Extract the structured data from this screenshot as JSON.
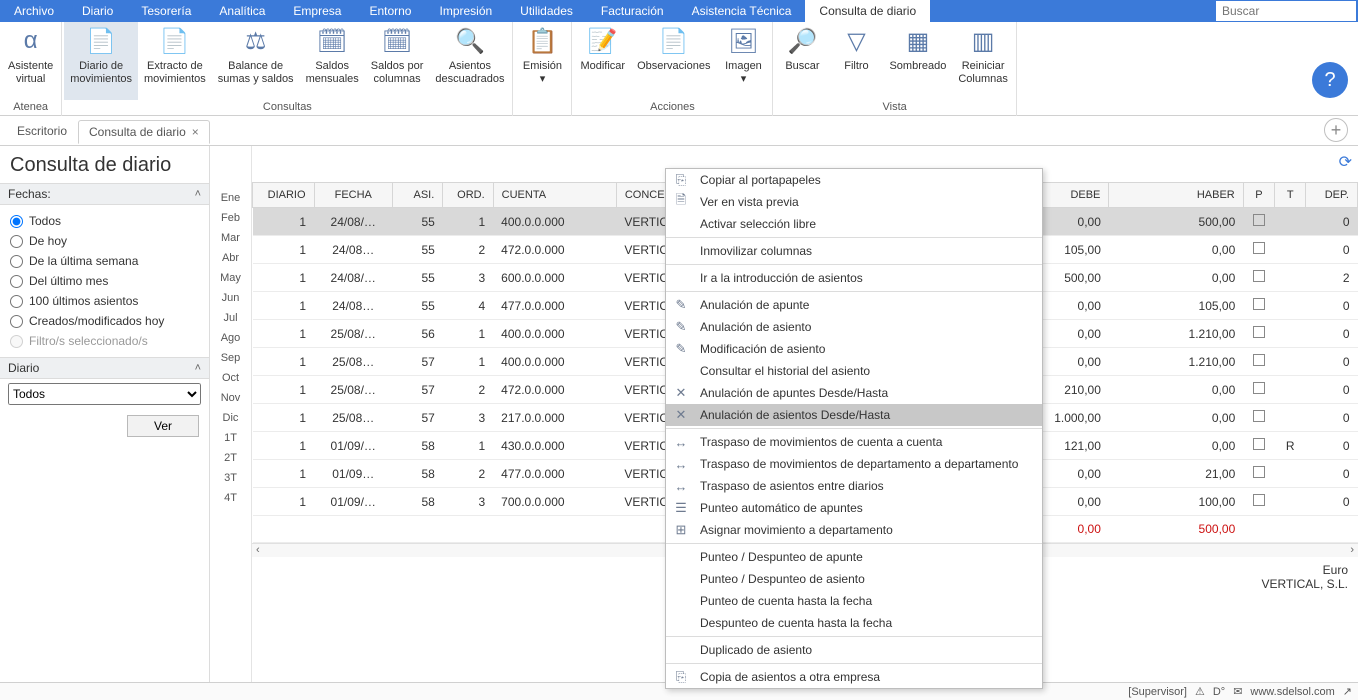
{
  "menubar": [
    "Archivo",
    "Diario",
    "Tesorería",
    "Analítica",
    "Empresa",
    "Entorno",
    "Impresión",
    "Utilidades",
    "Facturación",
    "Asistencia Técnica",
    "Consulta de diario"
  ],
  "menubar_active_index": 10,
  "search_placeholder": "Buscar",
  "ribbon": {
    "groups": [
      {
        "label": "Atenea",
        "buttons": [
          {
            "icon": "α",
            "label": "Asistente\nvirtual",
            "name": "asistente-virtual"
          }
        ]
      },
      {
        "label": "Consultas",
        "buttons": [
          {
            "icon": "📄",
            "label": "Diario de\nmovimientos",
            "name": "diario-de-movimientos",
            "selected": true
          },
          {
            "icon": "📄",
            "label": "Extracto de\nmovimientos",
            "name": "extracto-de-movimientos"
          },
          {
            "icon": "⚖",
            "label": "Balance de\nsumas y saldos",
            "name": "balance-sumas-saldos"
          },
          {
            "icon": "🗓",
            "label": "Saldos\nmensuales",
            "name": "saldos-mensuales"
          },
          {
            "icon": "🗓",
            "label": "Saldos por\ncolumnas",
            "name": "saldos-por-columnas"
          },
          {
            "icon": "🔍",
            "label": "Asientos\ndescuadrados",
            "name": "asientos-descuadrados"
          }
        ]
      },
      {
        "label": "",
        "buttons": [
          {
            "icon": "📋",
            "label": "Emisión\n▾",
            "name": "emision"
          }
        ]
      },
      {
        "label": "Acciones",
        "buttons": [
          {
            "icon": "📝",
            "label": "Modificar",
            "name": "modificar"
          },
          {
            "icon": "📄",
            "label": "Observaciones",
            "name": "observaciones"
          },
          {
            "icon": "🖼",
            "label": "Imagen\n▾",
            "name": "imagen"
          }
        ]
      },
      {
        "label": "Vista",
        "buttons": [
          {
            "icon": "🔎",
            "label": "Buscar",
            "name": "buscar"
          },
          {
            "icon": "▽",
            "label": "Filtro",
            "name": "filtro"
          },
          {
            "icon": "▦",
            "label": "Sombreado",
            "name": "sombreado"
          },
          {
            "icon": "▥",
            "label": "Reiniciar\nColumnas",
            "name": "reiniciar-columnas"
          }
        ]
      }
    ]
  },
  "tabs": {
    "escritorio": "Escritorio",
    "consulta": "Consulta de diario"
  },
  "page_title": "Consulta de diario",
  "fechas_label": "Fechas:",
  "radios": [
    "Todos",
    "De hoy",
    "De la última semana",
    "Del último mes",
    "100 últimos asientos",
    "Creados/modificados hoy",
    "Filtro/s seleccionado/s"
  ],
  "diario_label": "Diario",
  "diario_value": "Todos",
  "ver_label": "Ver",
  "months": [
    "Ene",
    "Feb",
    "Mar",
    "Abr",
    "May",
    "Jun",
    "Jul",
    "Ago",
    "Sep",
    "Oct",
    "Nov",
    "Dic",
    "1T",
    "2T",
    "3T",
    "4T"
  ],
  "columns": [
    "DIARIO",
    "FECHA",
    "ASI.",
    "ORD.",
    "CUENTA",
    "CONCEP",
    "DEBE",
    "HABER",
    "P",
    "T",
    "DEP."
  ],
  "rows": [
    {
      "diario": "1",
      "fecha": "24/08/…",
      "asi": "55",
      "ord": "1",
      "cuenta": "400.0.0.000",
      "concep": "VERTICAL",
      "debe": "0,00",
      "haber": "500,00",
      "p": "",
      "t": "",
      "dep": "0",
      "sel": true
    },
    {
      "diario": "1",
      "fecha": "24/08…",
      "asi": "55",
      "ord": "2",
      "cuenta": "472.0.0.000",
      "concep": "VERTICAL",
      "debe": "105,00",
      "haber": "0,00",
      "p": "",
      "t": "",
      "dep": "0"
    },
    {
      "diario": "1",
      "fecha": "24/08/…",
      "asi": "55",
      "ord": "3",
      "cuenta": "600.0.0.000",
      "concep": "VERTICAL",
      "debe": "500,00",
      "haber": "0,00",
      "p": "",
      "t": "",
      "dep": "2"
    },
    {
      "diario": "1",
      "fecha": "24/08…",
      "asi": "55",
      "ord": "4",
      "cuenta": "477.0.0.000",
      "concep": "VERTICAL",
      "debe": "0,00",
      "haber": "105,00",
      "p": "",
      "t": "",
      "dep": "0"
    },
    {
      "diario": "1",
      "fecha": "25/08/…",
      "asi": "56",
      "ord": "1",
      "cuenta": "400.0.0.000",
      "concep": "VERTICAL",
      "debe": "0,00",
      "haber": "1.210,00",
      "p": "",
      "t": "",
      "dep": "0"
    },
    {
      "diario": "1",
      "fecha": "25/08…",
      "asi": "57",
      "ord": "1",
      "cuenta": "400.0.0.000",
      "concep": "VERTICAL",
      "debe": "0,00",
      "haber": "1.210,00",
      "p": "",
      "t": "",
      "dep": "0"
    },
    {
      "diario": "1",
      "fecha": "25/08/…",
      "asi": "57",
      "ord": "2",
      "cuenta": "472.0.0.000",
      "concep": "VERTICAL",
      "debe": "210,00",
      "haber": "0,00",
      "p": "",
      "t": "",
      "dep": "0"
    },
    {
      "diario": "1",
      "fecha": "25/08…",
      "asi": "57",
      "ord": "3",
      "cuenta": "217.0.0.000",
      "concep": "VERTICAL",
      "debe": "1.000,00",
      "haber": "0,00",
      "p": "",
      "t": "",
      "dep": "0"
    },
    {
      "diario": "1",
      "fecha": "01/09/…",
      "asi": "58",
      "ord": "1",
      "cuenta": "430.0.0.000",
      "concep": "VERTICAL",
      "debe": "121,00",
      "haber": "0,00",
      "p": "",
      "t": "R",
      "dep": "0"
    },
    {
      "diario": "1",
      "fecha": "01/09…",
      "asi": "58",
      "ord": "2",
      "cuenta": "477.0.0.000",
      "concep": "VERTICAL",
      "debe": "0,00",
      "haber": "21,00",
      "p": "",
      "t": "",
      "dep": "0"
    },
    {
      "diario": "1",
      "fecha": "01/09/…",
      "asi": "58",
      "ord": "3",
      "cuenta": "700.0.0.000",
      "concep": "VERTICAL",
      "debe": "0,00",
      "haber": "100,00",
      "p": "",
      "t": "",
      "dep": "0"
    }
  ],
  "totals": {
    "debe": "0,00",
    "haber": "500,00"
  },
  "footer_currency": "Euro",
  "footer_company": "VERTICAL, S.L.",
  "context_menu": [
    {
      "icon": "⎘",
      "label": "Copiar al portapapeles"
    },
    {
      "icon": "🗎",
      "label": "Ver en vista previa"
    },
    {
      "label": "Activar selección libre"
    },
    {
      "sep": true
    },
    {
      "label": "Inmovilizar columnas"
    },
    {
      "sep": true
    },
    {
      "label": "Ir a la introducción de asientos"
    },
    {
      "sep": true
    },
    {
      "icon": "✎",
      "label": "Anulación de apunte"
    },
    {
      "icon": "✎",
      "label": "Anulación de asiento"
    },
    {
      "icon": "✎",
      "label": "Modificación de asiento"
    },
    {
      "label": "Consultar el historial del asiento"
    },
    {
      "icon": "✕",
      "label": "Anulación de apuntes Desde/Hasta"
    },
    {
      "icon": "✕",
      "label": "Anulación de asientos Desde/Hasta",
      "sel": true
    },
    {
      "sep": true
    },
    {
      "icon": "↔",
      "label": "Traspaso de movimientos de cuenta a cuenta"
    },
    {
      "icon": "↔",
      "label": "Traspaso de movimientos de departamento a departamento"
    },
    {
      "icon": "↔",
      "label": "Traspaso de asientos entre diarios"
    },
    {
      "icon": "☰",
      "label": "Punteo automático de apuntes"
    },
    {
      "icon": "⊞",
      "label": "Asignar movimiento a departamento"
    },
    {
      "sep": true
    },
    {
      "label": "Punteo / Despunteo de apunte"
    },
    {
      "label": "Punteo / Despunteo de asiento"
    },
    {
      "label": "Punteo de cuenta hasta la fecha"
    },
    {
      "label": "Despunteo de cuenta hasta la fecha"
    },
    {
      "sep": true
    },
    {
      "label": "Duplicado de asiento"
    },
    {
      "sep": true
    },
    {
      "icon": "⎘",
      "label": "Copia de asientos a otra empresa"
    }
  ],
  "status": {
    "user": "[Supervisor]",
    "url": "www.sdelsol.com",
    "icons": [
      "⚠",
      "D°",
      "✉",
      "↗"
    ]
  }
}
